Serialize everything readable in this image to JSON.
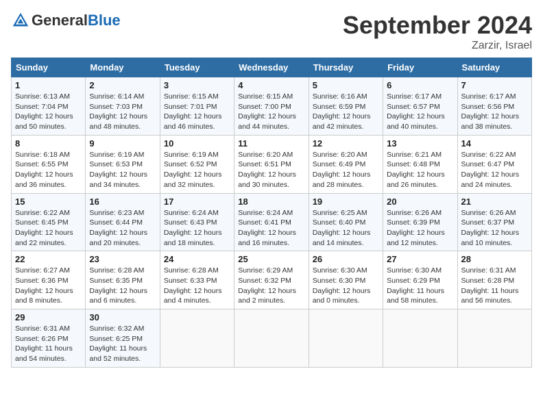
{
  "header": {
    "logo_general": "General",
    "logo_blue": "Blue",
    "month_title": "September 2024",
    "location": "Zarzir, Israel"
  },
  "weekdays": [
    "Sunday",
    "Monday",
    "Tuesday",
    "Wednesday",
    "Thursday",
    "Friday",
    "Saturday"
  ],
  "weeks": [
    [
      {
        "day": "1",
        "sunrise": "6:13 AM",
        "sunset": "7:04 PM",
        "daylight": "12 hours and 50 minutes."
      },
      {
        "day": "2",
        "sunrise": "6:14 AM",
        "sunset": "7:03 PM",
        "daylight": "12 hours and 48 minutes."
      },
      {
        "day": "3",
        "sunrise": "6:15 AM",
        "sunset": "7:01 PM",
        "daylight": "12 hours and 46 minutes."
      },
      {
        "day": "4",
        "sunrise": "6:15 AM",
        "sunset": "7:00 PM",
        "daylight": "12 hours and 44 minutes."
      },
      {
        "day": "5",
        "sunrise": "6:16 AM",
        "sunset": "6:59 PM",
        "daylight": "12 hours and 42 minutes."
      },
      {
        "day": "6",
        "sunrise": "6:17 AM",
        "sunset": "6:57 PM",
        "daylight": "12 hours and 40 minutes."
      },
      {
        "day": "7",
        "sunrise": "6:17 AM",
        "sunset": "6:56 PM",
        "daylight": "12 hours and 38 minutes."
      }
    ],
    [
      {
        "day": "8",
        "sunrise": "6:18 AM",
        "sunset": "6:55 PM",
        "daylight": "12 hours and 36 minutes."
      },
      {
        "day": "9",
        "sunrise": "6:19 AM",
        "sunset": "6:53 PM",
        "daylight": "12 hours and 34 minutes."
      },
      {
        "day": "10",
        "sunrise": "6:19 AM",
        "sunset": "6:52 PM",
        "daylight": "12 hours and 32 minutes."
      },
      {
        "day": "11",
        "sunrise": "6:20 AM",
        "sunset": "6:51 PM",
        "daylight": "12 hours and 30 minutes."
      },
      {
        "day": "12",
        "sunrise": "6:20 AM",
        "sunset": "6:49 PM",
        "daylight": "12 hours and 28 minutes."
      },
      {
        "day": "13",
        "sunrise": "6:21 AM",
        "sunset": "6:48 PM",
        "daylight": "12 hours and 26 minutes."
      },
      {
        "day": "14",
        "sunrise": "6:22 AM",
        "sunset": "6:47 PM",
        "daylight": "12 hours and 24 minutes."
      }
    ],
    [
      {
        "day": "15",
        "sunrise": "6:22 AM",
        "sunset": "6:45 PM",
        "daylight": "12 hours and 22 minutes."
      },
      {
        "day": "16",
        "sunrise": "6:23 AM",
        "sunset": "6:44 PM",
        "daylight": "12 hours and 20 minutes."
      },
      {
        "day": "17",
        "sunrise": "6:24 AM",
        "sunset": "6:43 PM",
        "daylight": "12 hours and 18 minutes."
      },
      {
        "day": "18",
        "sunrise": "6:24 AM",
        "sunset": "6:41 PM",
        "daylight": "12 hours and 16 minutes."
      },
      {
        "day": "19",
        "sunrise": "6:25 AM",
        "sunset": "6:40 PM",
        "daylight": "12 hours and 14 minutes."
      },
      {
        "day": "20",
        "sunrise": "6:26 AM",
        "sunset": "6:39 PM",
        "daylight": "12 hours and 12 minutes."
      },
      {
        "day": "21",
        "sunrise": "6:26 AM",
        "sunset": "6:37 PM",
        "daylight": "12 hours and 10 minutes."
      }
    ],
    [
      {
        "day": "22",
        "sunrise": "6:27 AM",
        "sunset": "6:36 PM",
        "daylight": "12 hours and 8 minutes."
      },
      {
        "day": "23",
        "sunrise": "6:28 AM",
        "sunset": "6:35 PM",
        "daylight": "12 hours and 6 minutes."
      },
      {
        "day": "24",
        "sunrise": "6:28 AM",
        "sunset": "6:33 PM",
        "daylight": "12 hours and 4 minutes."
      },
      {
        "day": "25",
        "sunrise": "6:29 AM",
        "sunset": "6:32 PM",
        "daylight": "12 hours and 2 minutes."
      },
      {
        "day": "26",
        "sunrise": "6:30 AM",
        "sunset": "6:30 PM",
        "daylight": "12 hours and 0 minutes."
      },
      {
        "day": "27",
        "sunrise": "6:30 AM",
        "sunset": "6:29 PM",
        "daylight": "11 hours and 58 minutes."
      },
      {
        "day": "28",
        "sunrise": "6:31 AM",
        "sunset": "6:28 PM",
        "daylight": "11 hours and 56 minutes."
      }
    ],
    [
      {
        "day": "29",
        "sunrise": "6:31 AM",
        "sunset": "6:26 PM",
        "daylight": "11 hours and 54 minutes."
      },
      {
        "day": "30",
        "sunrise": "6:32 AM",
        "sunset": "6:25 PM",
        "daylight": "11 hours and 52 minutes."
      },
      null,
      null,
      null,
      null,
      null
    ]
  ]
}
